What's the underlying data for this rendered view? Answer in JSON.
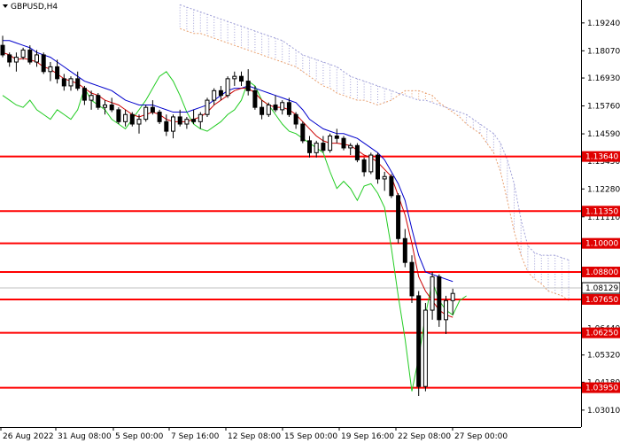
{
  "chart_data": {
    "type": "candlestick",
    "title": "GBPUSD,H4",
    "symbol_menu_icon": "triangle-down-icon",
    "ylim": [
      1.023,
      1.202
    ],
    "price_ticks": [
      "1.19240",
      "1.18070",
      "1.16930",
      "1.15760",
      "1.14590",
      "1.13450",
      "1.12280",
      "1.11110",
      "1.09940",
      "1.08770",
      "1.07610",
      "1.06440",
      "1.05320",
      "1.04180",
      "1.03010"
    ],
    "x_labels": [
      "26 Aug 2022",
      "31 Aug 08:00",
      "5 Sep 00:00",
      "7 Sep 16:00",
      "12 Sep 08:00",
      "15 Sep 00:00",
      "19 Sep 16:00",
      "22 Sep 08:00",
      "27 Sep 00:00"
    ],
    "current_price": {
      "value": 1.08129,
      "label": "1.08129"
    },
    "levels": [
      {
        "value": 1.1364,
        "label": "1.13640"
      },
      {
        "value": 1.1135,
        "label": "1.11350"
      },
      {
        "value": 1.1,
        "label": "1.10000"
      },
      {
        "value": 1.088,
        "label": "1.08800"
      },
      {
        "value": 1.0765,
        "label": "1.07650"
      },
      {
        "value": 1.0625,
        "label": "1.06250"
      },
      {
        "value": 1.0395,
        "label": "1.03950"
      }
    ],
    "colors": {
      "level": "#ff0000",
      "label_bg": "#e00000",
      "tenkan": "#cc0000",
      "kijun": "#0000cc",
      "chikou": "#22cc22",
      "senkou_a": "#e8a070",
      "senkou_b": "#a0a0d8",
      "candle": "#000000",
      "current": "#c0c0c0"
    },
    "candles": [
      [
        1.183,
        1.187,
        1.178,
        1.179
      ],
      [
        1.179,
        1.18,
        1.174,
        1.176
      ],
      [
        1.176,
        1.18,
        1.172,
        1.178
      ],
      [
        1.178,
        1.182,
        1.177,
        1.181
      ],
      [
        1.181,
        1.183,
        1.175,
        1.176
      ],
      [
        1.176,
        1.181,
        1.174,
        1.179
      ],
      [
        1.179,
        1.18,
        1.171,
        1.172
      ],
      [
        1.172,
        1.176,
        1.168,
        1.174
      ],
      [
        1.174,
        1.177,
        1.167,
        1.169
      ],
      [
        1.169,
        1.171,
        1.164,
        1.166
      ],
      [
        1.166,
        1.17,
        1.164,
        1.169
      ],
      [
        1.169,
        1.172,
        1.164,
        1.165
      ],
      [
        1.165,
        1.166,
        1.158,
        1.16
      ],
      [
        1.16,
        1.164,
        1.156,
        1.162
      ],
      [
        1.162,
        1.163,
        1.156,
        1.157
      ],
      [
        1.157,
        1.16,
        1.154,
        1.158
      ],
      [
        1.158,
        1.161,
        1.155,
        1.156
      ],
      [
        1.156,
        1.157,
        1.15,
        1.151
      ],
      [
        1.151,
        1.156,
        1.149,
        1.154
      ],
      [
        1.154,
        1.155,
        1.149,
        1.15
      ],
      [
        1.15,
        1.154,
        1.146,
        1.152
      ],
      [
        1.152,
        1.158,
        1.151,
        1.157
      ],
      [
        1.157,
        1.16,
        1.154,
        1.155
      ],
      [
        1.155,
        1.156,
        1.15,
        1.151
      ],
      [
        1.151,
        1.154,
        1.145,
        1.147
      ],
      [
        1.147,
        1.154,
        1.144,
        1.153
      ],
      [
        1.153,
        1.156,
        1.149,
        1.15
      ],
      [
        1.15,
        1.153,
        1.148,
        1.152
      ],
      [
        1.152,
        1.156,
        1.15,
        1.151
      ],
      [
        1.151,
        1.155,
        1.148,
        1.154
      ],
      [
        1.154,
        1.161,
        1.153,
        1.16
      ],
      [
        1.16,
        1.165,
        1.158,
        1.164
      ],
      [
        1.164,
        1.166,
        1.16,
        1.162
      ],
      [
        1.162,
        1.17,
        1.161,
        1.169
      ],
      [
        1.169,
        1.172,
        1.166,
        1.17
      ],
      [
        1.17,
        1.172,
        1.166,
        1.168
      ],
      [
        1.168,
        1.173,
        1.162,
        1.164
      ],
      [
        1.164,
        1.166,
        1.156,
        1.157
      ],
      [
        1.157,
        1.16,
        1.152,
        1.154
      ],
      [
        1.154,
        1.159,
        1.153,
        1.158
      ],
      [
        1.158,
        1.162,
        1.155,
        1.156
      ],
      [
        1.156,
        1.16,
        1.154,
        1.159
      ],
      [
        1.159,
        1.161,
        1.153,
        1.154
      ],
      [
        1.154,
        1.155,
        1.148,
        1.15
      ],
      [
        1.15,
        1.151,
        1.142,
        1.143
      ],
      [
        1.143,
        1.145,
        1.136,
        1.138
      ],
      [
        1.138,
        1.143,
        1.136,
        1.142
      ],
      [
        1.142,
        1.145,
        1.138,
        1.139
      ],
      [
        1.139,
        1.146,
        1.138,
        1.145
      ],
      [
        1.145,
        1.148,
        1.142,
        1.144
      ],
      [
        1.144,
        1.145,
        1.139,
        1.14
      ],
      [
        1.14,
        1.142,
        1.137,
        1.141
      ],
      [
        1.141,
        1.142,
        1.134,
        1.135
      ],
      [
        1.135,
        1.136,
        1.128,
        1.13
      ],
      [
        1.13,
        1.138,
        1.129,
        1.137
      ],
      [
        1.137,
        1.138,
        1.125,
        1.127
      ],
      [
        1.127,
        1.13,
        1.122,
        1.128
      ],
      [
        1.128,
        1.129,
        1.119,
        1.12
      ],
      [
        1.12,
        1.121,
        1.1,
        1.102
      ],
      [
        1.102,
        1.106,
        1.09,
        1.092
      ],
      [
        1.092,
        1.095,
        1.075,
        1.078
      ],
      [
        1.078,
        1.08,
        1.036,
        1.04
      ],
      [
        1.04,
        1.075,
        1.038,
        1.072
      ],
      [
        1.072,
        1.088,
        1.068,
        1.086
      ],
      [
        1.086,
        1.087,
        1.065,
        1.068
      ],
      [
        1.068,
        1.078,
        1.062,
        1.076
      ],
      [
        1.076,
        1.081,
        1.07,
        1.079
      ]
    ],
    "tenkan": [
      1.18,
      1.179,
      1.177,
      1.1775,
      1.177,
      1.176,
      1.174,
      1.173,
      1.171,
      1.169,
      1.168,
      1.167,
      1.165,
      1.163,
      1.162,
      1.16,
      1.159,
      1.158,
      1.156,
      1.154,
      1.153,
      1.154,
      1.155,
      1.154,
      1.152,
      1.151,
      1.151,
      1.151,
      1.152,
      1.153,
      1.155,
      1.158,
      1.16,
      1.162,
      1.164,
      1.165,
      1.165,
      1.163,
      1.16,
      1.158,
      1.157,
      1.157,
      1.156,
      1.154,
      1.151,
      1.148,
      1.145,
      1.143,
      1.142,
      1.142,
      1.1415,
      1.141,
      1.139,
      1.137,
      1.136,
      1.134,
      1.131,
      1.128,
      1.12,
      1.112,
      1.1,
      1.086,
      1.08,
      1.076,
      1.072,
      1.07,
      1.069
    ],
    "kijun": [
      1.185,
      1.185,
      1.184,
      1.183,
      1.182,
      1.18,
      1.179,
      1.178,
      1.176,
      1.174,
      1.172,
      1.17,
      1.168,
      1.167,
      1.166,
      1.165,
      1.164,
      1.162,
      1.16,
      1.159,
      1.158,
      1.158,
      1.158,
      1.157,
      1.156,
      1.155,
      1.155,
      1.155,
      1.156,
      1.157,
      1.158,
      1.16,
      1.162,
      1.164,
      1.165,
      1.165,
      1.166,
      1.165,
      1.164,
      1.163,
      1.162,
      1.161,
      1.16,
      1.159,
      1.156,
      1.152,
      1.15,
      1.148,
      1.147,
      1.146,
      1.146,
      1.145,
      1.144,
      1.142,
      1.14,
      1.138,
      1.135,
      1.13,
      1.125,
      1.118,
      1.106,
      1.095,
      1.088,
      1.087,
      1.086,
      1.085,
      1.084
    ],
    "chikou": [
      1.162,
      1.16,
      1.158,
      1.157,
      1.16,
      1.156,
      1.154,
      1.152,
      1.156,
      1.154,
      1.152,
      1.156,
      1.165,
      1.16,
      1.158,
      1.156,
      1.152,
      1.15,
      1.148,
      1.152,
      1.156,
      1.16,
      1.165,
      1.17,
      1.172,
      1.168,
      1.162,
      1.155,
      1.15,
      1.148,
      1.147,
      1.149,
      1.151,
      1.154,
      1.156,
      1.16,
      1.168,
      1.166,
      1.16,
      1.158,
      1.154,
      1.15,
      1.147,
      1.146,
      1.144,
      1.142,
      1.14,
      1.138,
      1.13,
      1.123,
      1.126,
      1.123,
      1.118,
      1.124,
      1.125,
      1.121,
      1.115,
      1.098,
      1.078,
      1.06,
      1.038,
      1.052,
      1.07,
      1.084,
      1.076,
      1.072,
      1.07,
      1.076,
      1.078
    ],
    "cloud_a": [
      1.19,
      1.189,
      1.188,
      1.188,
      1.187,
      1.186,
      1.185,
      1.184,
      1.183,
      1.182,
      1.181,
      1.18,
      1.179,
      1.178,
      1.177,
      1.176,
      1.175,
      1.174,
      1.172,
      1.17,
      1.168,
      1.166,
      1.165,
      1.163,
      1.162,
      1.161,
      1.16,
      1.16,
      1.159,
      1.158,
      1.159,
      1.16,
      1.162,
      1.164,
      1.164,
      1.164,
      1.163,
      1.162,
      1.159,
      1.157,
      1.155,
      1.153,
      1.15,
      1.148,
      1.146,
      1.142,
      1.138,
      1.13,
      1.118,
      1.105,
      1.095,
      1.088,
      1.085,
      1.083,
      1.08,
      1.079,
      1.078,
      1.076
    ],
    "cloud_b": [
      1.2,
      1.199,
      1.198,
      1.197,
      1.196,
      1.195,
      1.194,
      1.193,
      1.192,
      1.191,
      1.19,
      1.189,
      1.188,
      1.187,
      1.186,
      1.185,
      1.183,
      1.181,
      1.179,
      1.178,
      1.177,
      1.176,
      1.175,
      1.174,
      1.172,
      1.17,
      1.169,
      1.168,
      1.167,
      1.166,
      1.165,
      1.164,
      1.163,
      1.162,
      1.161,
      1.16,
      1.16,
      1.159,
      1.158,
      1.157,
      1.156,
      1.155,
      1.154,
      1.152,
      1.15,
      1.148,
      1.146,
      1.142,
      1.135,
      1.125,
      1.11,
      1.099,
      1.096,
      1.095,
      1.095,
      1.095,
      1.094,
      1.093
    ]
  }
}
